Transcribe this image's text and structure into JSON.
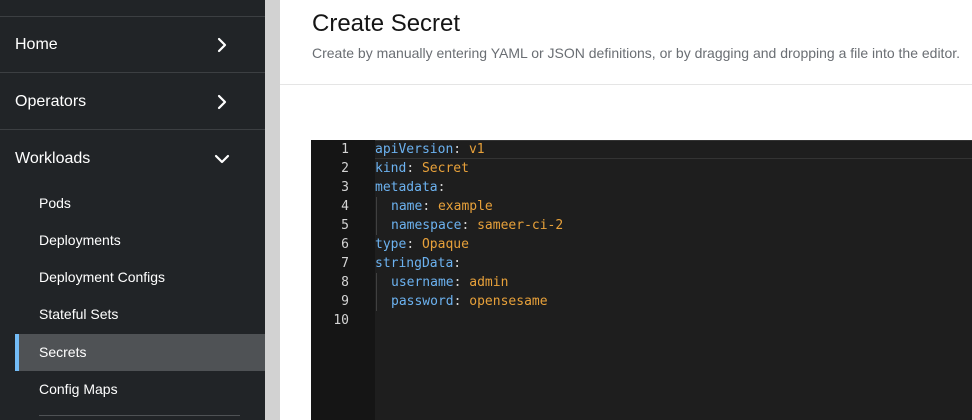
{
  "sidebar": {
    "sections": [
      {
        "label": "Home",
        "icon": "chevron-right-icon"
      },
      {
        "label": "Operators",
        "icon": "chevron-right-icon"
      },
      {
        "label": "Workloads",
        "icon": "chevron-down-icon"
      }
    ],
    "workloads_items": [
      {
        "label": "Pods"
      },
      {
        "label": "Deployments"
      },
      {
        "label": "Deployment Configs"
      },
      {
        "label": "Stateful Sets"
      },
      {
        "label": "Secrets",
        "active": true
      },
      {
        "label": "Config Maps"
      }
    ]
  },
  "page": {
    "title": "Create Secret",
    "description": "Create by manually entering YAML or JSON definitions, or by dragging and dropping a file into the editor."
  },
  "editor": {
    "line_numbers": [
      "1",
      "2",
      "3",
      "4",
      "5",
      "6",
      "7",
      "8",
      "9",
      "10"
    ],
    "lines": [
      {
        "key": "apiVersion",
        "sep": ": ",
        "value": "v1"
      },
      {
        "key": "kind",
        "sep": ": ",
        "value": "Secret"
      },
      {
        "key": "metadata",
        "sep": ":",
        "value": ""
      },
      {
        "key": "name",
        "sep": ": ",
        "value": "example"
      },
      {
        "key": "namespace",
        "sep": ": ",
        "value": "sameer-ci-2"
      },
      {
        "key": "type",
        "sep": ": ",
        "value": "Opaque"
      },
      {
        "key": "stringData",
        "sep": ":",
        "value": ""
      },
      {
        "key": "username",
        "sep": ": ",
        "value": "admin"
      },
      {
        "key": "password",
        "sep": ": ",
        "value": "opensesame"
      }
    ]
  },
  "colors": {
    "sidebar_bg": "#212427",
    "active_item_bg": "#4f5255",
    "active_accent": "#73bcf7",
    "editor_bg": "#1e1e1e",
    "yaml_key": "#6cb2f0",
    "yaml_value": "#e8a13a"
  }
}
